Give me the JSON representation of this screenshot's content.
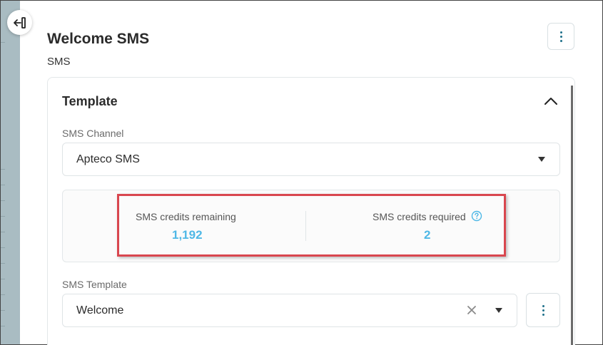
{
  "header": {
    "title": "Welcome SMS",
    "subtitle": "SMS"
  },
  "template_section": {
    "title": "Template",
    "expanded": true,
    "sms_channel": {
      "label": "SMS Channel",
      "value": "Apteco SMS"
    },
    "credits": {
      "remaining_label": "SMS credits remaining",
      "remaining_value": "1,192",
      "required_label": "SMS credits required",
      "required_value": "2"
    },
    "sms_template": {
      "label": "SMS Template",
      "value": "Welcome"
    }
  },
  "icons": {
    "collapse_sidebar": "arrow-left-bar-icon",
    "page_menu": "vertical-dots-icon",
    "section_toggle": "chevron-up-icon",
    "help": "question-circle-icon",
    "clear": "close-x-icon",
    "dropdown": "caret-down-icon",
    "template_menu": "vertical-dots-icon"
  },
  "colors": {
    "accent": "#4fb8e6",
    "icon_teal": "#1d6f8a",
    "highlight_red": "#d9474f",
    "side_strip": "#a9bcc2"
  }
}
